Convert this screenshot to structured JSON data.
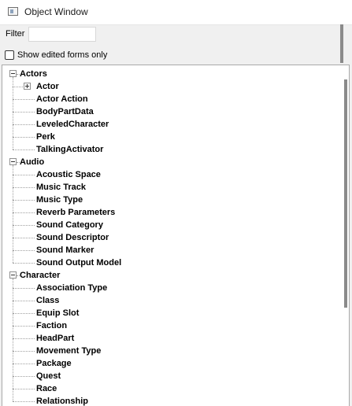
{
  "window": {
    "title": "Object Window"
  },
  "filter": {
    "label": "Filter",
    "value": "",
    "placeholder": ""
  },
  "show_edited": {
    "label": "Show edited forms only",
    "checked": false
  },
  "tree": [
    {
      "label": "Actors",
      "expanded": true,
      "children": [
        {
          "label": "Actor",
          "has_children": true
        },
        {
          "label": "Actor Action"
        },
        {
          "label": "BodyPartData"
        },
        {
          "label": "LeveledCharacter"
        },
        {
          "label": "Perk"
        },
        {
          "label": "TalkingActivator"
        }
      ]
    },
    {
      "label": "Audio",
      "expanded": true,
      "children": [
        {
          "label": "Acoustic Space"
        },
        {
          "label": "Music Track"
        },
        {
          "label": "Music Type"
        },
        {
          "label": "Reverb Parameters"
        },
        {
          "label": "Sound Category"
        },
        {
          "label": "Sound Descriptor"
        },
        {
          "label": "Sound Marker"
        },
        {
          "label": "Sound Output Model"
        }
      ]
    },
    {
      "label": "Character",
      "expanded": true,
      "children": [
        {
          "label": "Association Type"
        },
        {
          "label": "Class"
        },
        {
          "label": "Equip Slot"
        },
        {
          "label": "Faction"
        },
        {
          "label": "HeadPart"
        },
        {
          "label": "Movement Type"
        },
        {
          "label": "Package"
        },
        {
          "label": "Quest"
        },
        {
          "label": "Race"
        },
        {
          "label": "Relationship"
        }
      ]
    }
  ]
}
